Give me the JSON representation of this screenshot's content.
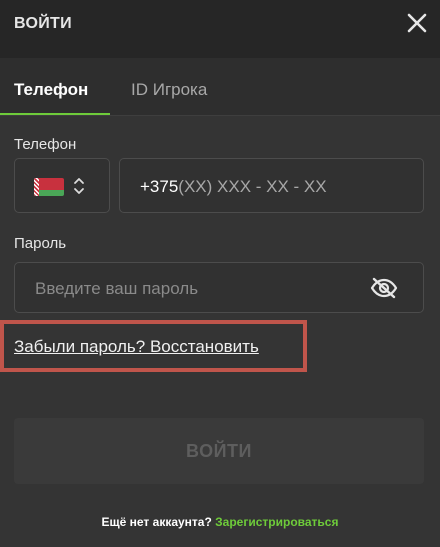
{
  "header": {
    "title": "ВОЙТИ",
    "close_icon": "close-icon"
  },
  "tabs": [
    {
      "label": "Телефон",
      "active": true
    },
    {
      "label": "ID Игрока",
      "active": false
    }
  ],
  "colors": {
    "accent": "#6ecb3a",
    "highlight_border": "#c0554b",
    "background": "#343434"
  },
  "phone": {
    "label": "Телефон",
    "country": {
      "flag_icon": "belarus-flag-icon",
      "toggle_icon": "updown-chevron-icon"
    },
    "prefix": "+375",
    "mask": "(XX) XXX - XX - XX"
  },
  "password": {
    "label": "Пароль",
    "placeholder": "Введите ваш пароль",
    "toggle_icon": "eye-slash-icon"
  },
  "forgot": {
    "label": "Забыли пароль? Восстановить"
  },
  "login_button": {
    "label": "ВОЙТИ"
  },
  "footer": {
    "question": "Ещё нет аккаунта?",
    "register": "Зарегистрироваться"
  }
}
